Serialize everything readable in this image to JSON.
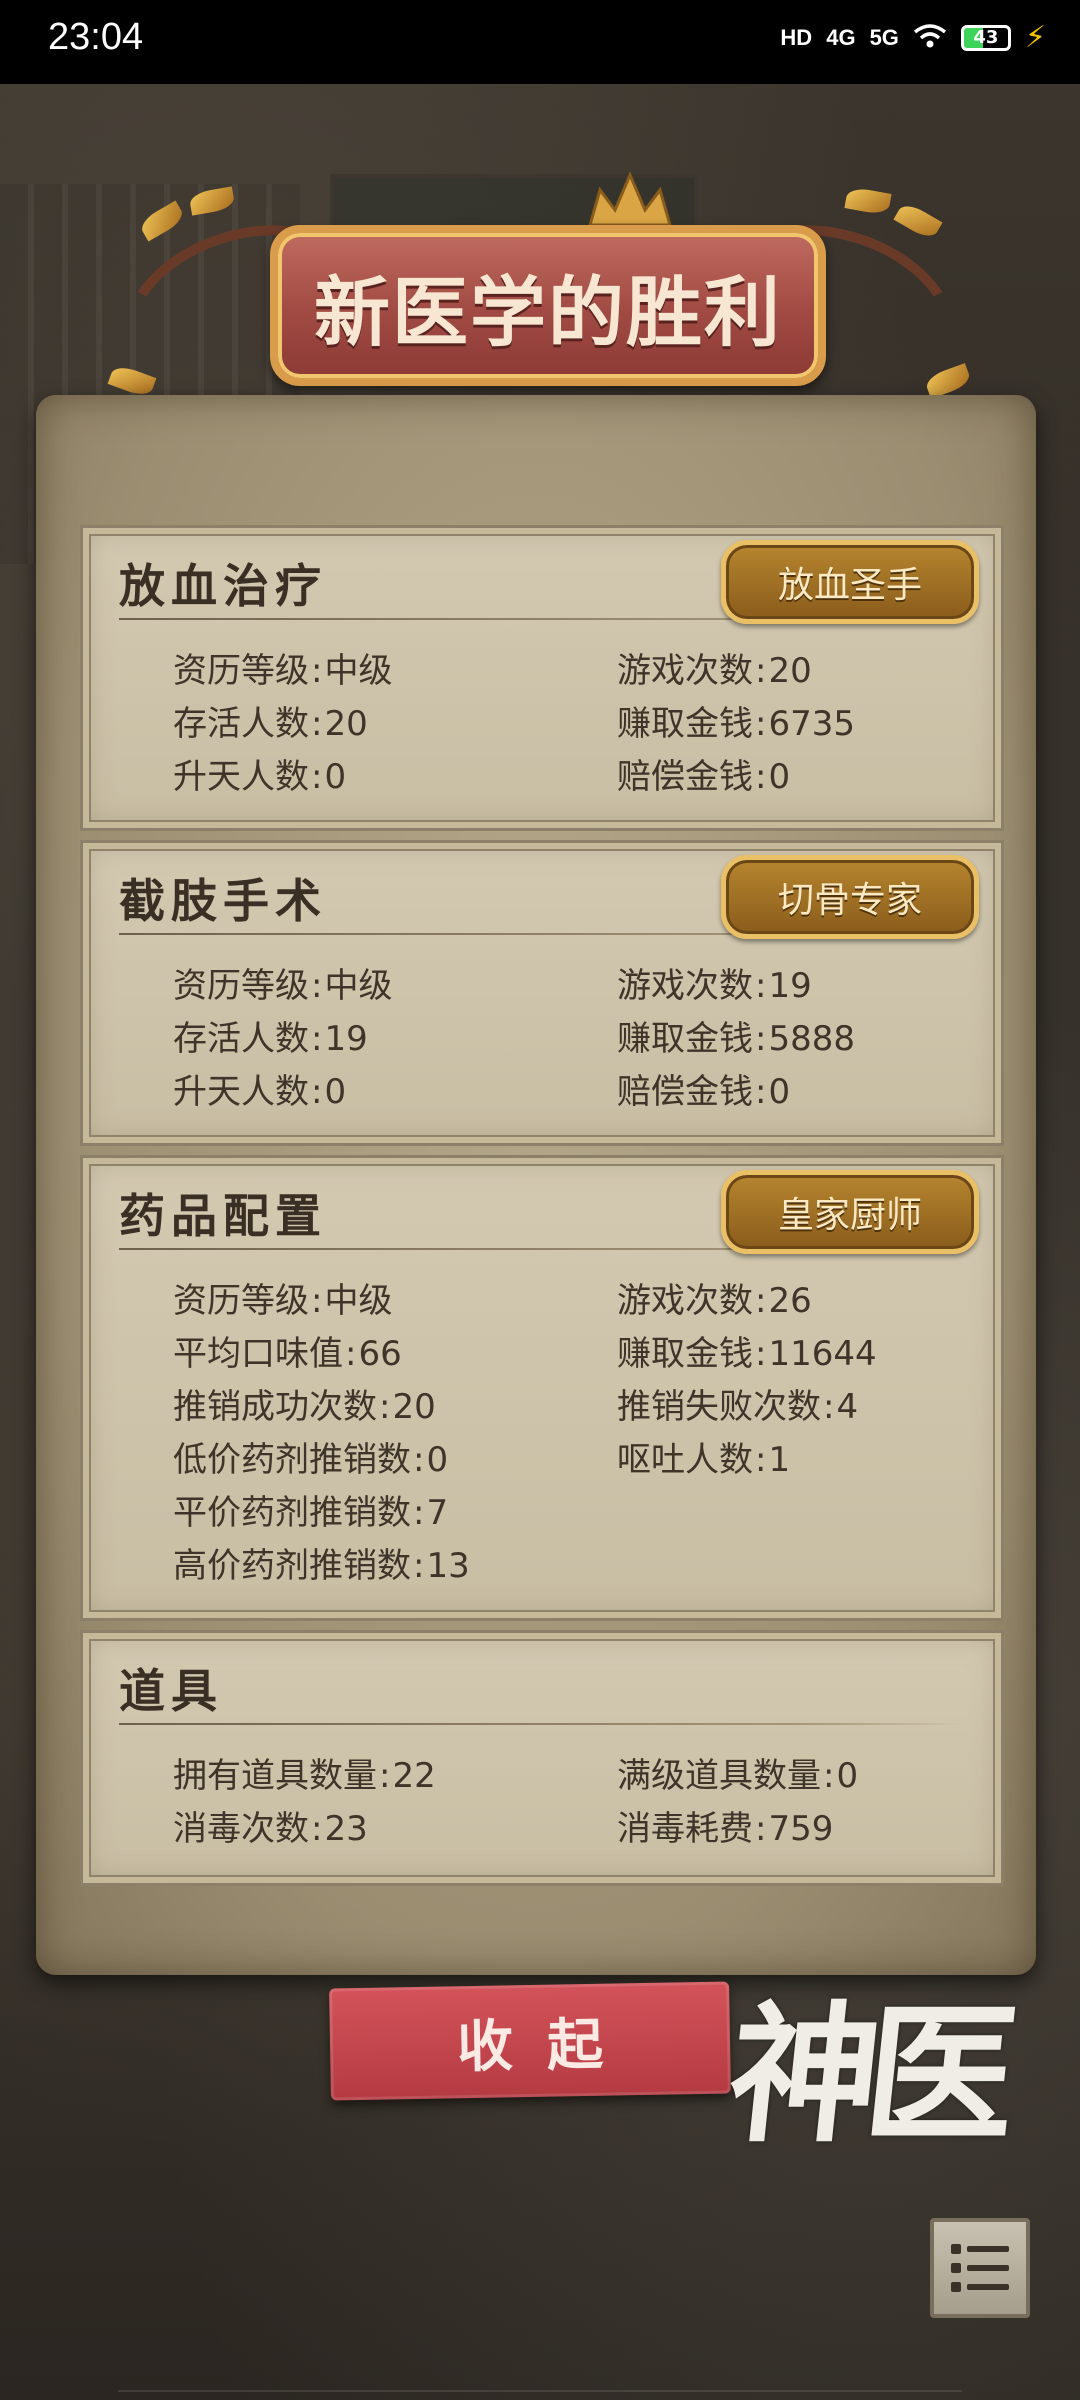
{
  "status_bar": {
    "time": "23:04",
    "hd": "HD",
    "net1": "4G",
    "net2": "5G",
    "battery": "43"
  },
  "title": "新医学的胜利",
  "sections": [
    {
      "title": "放血治疗",
      "badge": "放血圣手",
      "left": [
        {
          "label": "资历等级",
          "value": "中级"
        },
        {
          "label": "存活人数",
          "value": "20"
        },
        {
          "label": "升天人数",
          "value": "0"
        }
      ],
      "right": [
        {
          "label": "游戏次数",
          "value": "20"
        },
        {
          "label": "赚取金钱",
          "value": "6735"
        },
        {
          "label": "赔偿金钱",
          "value": "0"
        }
      ]
    },
    {
      "title": "截肢手术",
      "badge": "切骨专家",
      "left": [
        {
          "label": "资历等级",
          "value": "中级"
        },
        {
          "label": "存活人数",
          "value": "19"
        },
        {
          "label": "升天人数",
          "value": "0"
        }
      ],
      "right": [
        {
          "label": "游戏次数",
          "value": "19"
        },
        {
          "label": "赚取金钱",
          "value": "5888"
        },
        {
          "label": "赔偿金钱",
          "value": "0"
        }
      ]
    },
    {
      "title": "药品配置",
      "badge": "皇家厨师",
      "left": [
        {
          "label": "资历等级",
          "value": "中级"
        },
        {
          "label": "平均口味值",
          "value": "66"
        },
        {
          "label": "推销成功次数",
          "value": "20"
        },
        {
          "label": "低价药剂推销数",
          "value": "0"
        },
        {
          "label": "平价药剂推销数",
          "value": "7"
        },
        {
          "label": "高价药剂推销数",
          "value": "13"
        }
      ],
      "right": [
        {
          "label": "游戏次数",
          "value": "26"
        },
        {
          "label": "赚取金钱",
          "value": "11644"
        },
        {
          "label": "推销失败次数",
          "value": "4"
        },
        {
          "label": "呕吐人数",
          "value": "1"
        }
      ]
    },
    {
      "title": "道具",
      "left": [
        {
          "label": "拥有道具数量",
          "value": "22"
        },
        {
          "label": "消毒次数",
          "value": "23"
        }
      ],
      "right": [
        {
          "label": "满级道具数量",
          "value": "0"
        },
        {
          "label": "消毒耗费",
          "value": "759"
        }
      ]
    }
  ],
  "collapse_button": "收起",
  "logo_text": "神医",
  "icons": {
    "menu": "list-icon",
    "wifi": "wifi-icon",
    "charging": "bolt-icon"
  }
}
